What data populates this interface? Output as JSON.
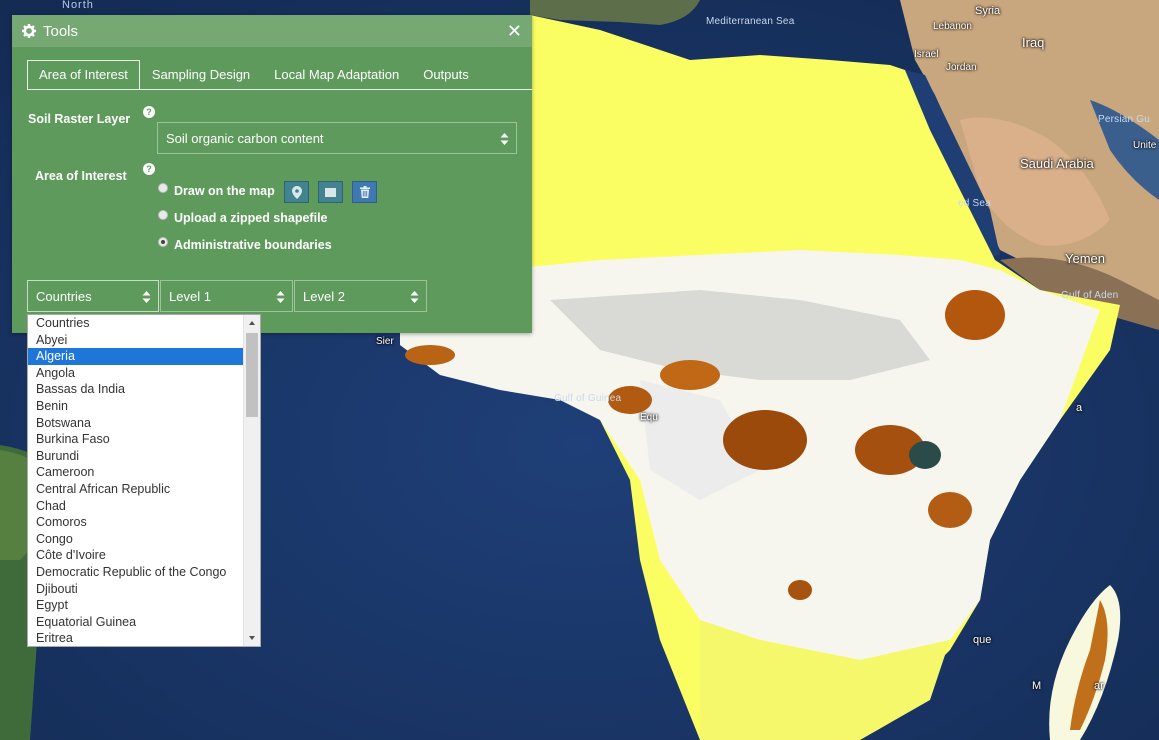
{
  "map": {
    "labels": {
      "north": "North",
      "mediterranean": "Mediterranean Sea",
      "syria": "Syria",
      "lebanon": "Lebanon",
      "iraq": "Iraq",
      "israel": "Israel",
      "jordan": "Jordan",
      "persian": "Persian Gu",
      "united": "Unite",
      "saudi": "Saudi Arabia",
      "redsea": "ed Sea",
      "yemen": "Yemen",
      "aden": "Gulf of Aden",
      "guinea": "Gulf of Guinea",
      "sierra": "Sier",
      "equ": "Equ",
      "somalia_frag": "a",
      "mozambique_frag": "que",
      "madagascar_left": "M",
      "madagascar_right": "ar"
    }
  },
  "tools": {
    "title": "Tools",
    "tabs": [
      "Area of Interest",
      "Sampling Design",
      "Local Map Adaptation",
      "Outputs"
    ],
    "active_tab": "Area of Interest",
    "soil_raster_label": "Soil Raster Layer",
    "soil_raster_value": "Soil organic carbon content",
    "aoi_label": "Area of Interest",
    "help_glyph": "?",
    "options": [
      {
        "label": "Draw on the map",
        "checked": false
      },
      {
        "label": "Upload a zipped shapefile",
        "checked": false
      },
      {
        "label": "Administrative boundaries",
        "checked": true
      }
    ],
    "selects": {
      "countries": "Countries",
      "level1": "Level 1",
      "level2": "Level 2"
    }
  },
  "country_list": {
    "selected": "Algeria",
    "items": [
      "Countries",
      "Abyei",
      "Algeria",
      "Angola",
      "Bassas da India",
      "Benin",
      "Botswana",
      "Burkina Faso",
      "Burundi",
      "Cameroon",
      "Central African Republic",
      "Chad",
      "Comoros",
      "Congo",
      "Côte d'Ivoire",
      "Democratic Republic of the Congo",
      "Djibouti",
      "Egypt",
      "Equatorial Guinea",
      "Eritrea"
    ]
  },
  "colors": {
    "panel": "#5e9a5c",
    "header": "#75a873",
    "selected_item": "#1e76d9"
  }
}
